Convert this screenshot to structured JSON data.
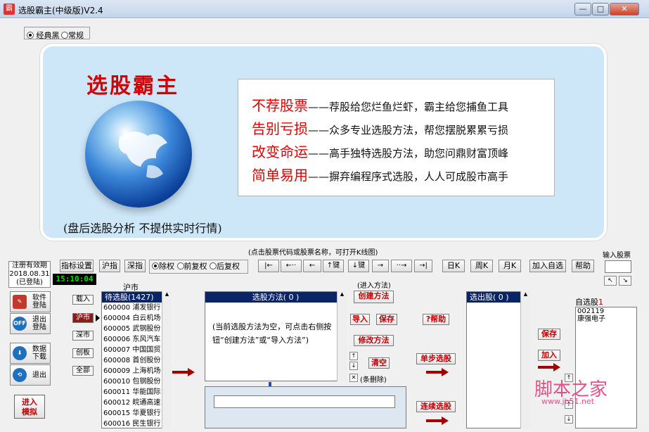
{
  "window": {
    "icon_text": "霸",
    "title": "选股霸主(中级版)V2.4",
    "min_glyph": "—",
    "max_glyph": "□",
    "close_glyph": "✕"
  },
  "theme": {
    "option1": "经典黑",
    "option2": "常规",
    "selected": "经典黑"
  },
  "banner": {
    "brand": "选股霸主",
    "note": "(盘后选股分析  不提供实时行情)",
    "slogans": [
      {
        "head": "不荐股票",
        "text": "——荐股给您烂鱼烂虾，霸主给您捕鱼工具"
      },
      {
        "head": "告别亏损",
        "text": "——众多专业选股方法，帮您摆脱累累亏损"
      },
      {
        "head": "改变命运",
        "text": "——高手独特选股方法，助您问鼎财富顶峰"
      },
      {
        "head": "简单易用",
        "text": "——摒弃编程序式选股，人人可成股市高手"
      }
    ]
  },
  "hint_open_kline": "(点击股票代码或股票名称，可打开K线图)",
  "registration": {
    "line1": "注册有效期",
    "line2": "2018.08.31",
    "line3": "(已登陆)"
  },
  "clock": "15:10:04",
  "toolbar": {
    "indicator_settings": "指标设置",
    "sh_index": "沪指",
    "sz_index": "深指",
    "fq_options": [
      "除权",
      "前复权",
      "后复权"
    ],
    "fq_selected": "除权",
    "nav_buttons": [
      "|←",
      "←··",
      "←",
      "↑键",
      "↓键",
      "→",
      "··→",
      "→|"
    ],
    "day_k": "日K",
    "week_k": "周K",
    "month_k": "月K",
    "add_watch": "加入自选",
    "help": "帮助",
    "input_code_label": "输入股票",
    "arrow_left": "↖",
    "arrow_right": "↘"
  },
  "sidebar": {
    "software_login": {
      "line1": "软件",
      "line2": "登陆"
    },
    "logout": {
      "line1": "退出",
      "line2": "登陆",
      "icon": "OFF"
    },
    "data_download": {
      "line1": "数据",
      "line2": "下载"
    },
    "exit": {
      "line1": "退出"
    },
    "enter_model": {
      "line1": "进入",
      "line2": "模拟"
    }
  },
  "market": {
    "label": "沪市",
    "buttons": [
      "载入",
      "沪市",
      "深市",
      "创板",
      "全部"
    ],
    "selected": "沪市"
  },
  "pending_list": {
    "header": "待选股(1427)",
    "rows": [
      "600000 浦发银行",
      "600004 白云机场",
      "600005 武钢股份",
      "600006 东风汽车",
      "600007 中国国贸",
      "600008 首创股份",
      "600009 上海机场",
      "600010 包钢股份",
      "600011 华能国际",
      "600012 皖通高速",
      "600015 华夏银行",
      "600016 民生银行"
    ]
  },
  "method": {
    "header": "选股方法(   0   )",
    "enter_label": "(进入方法)",
    "empty_hint": "(当前选股方法为空，可点击右侧按钮“创建方法”或“导入方法”)",
    "create": "创建方法",
    "import": "导入",
    "save": "保存",
    "edit": "修改方法",
    "clear": "清空",
    "delete_hint": "(条删除)",
    "help": "?帮助",
    "single_step": "单步选股",
    "continuous": "连续选股"
  },
  "selected_list": {
    "header": "选出股(   0   )"
  },
  "watchlist": {
    "label": "自选股",
    "count": "1",
    "save": "保存",
    "add": "加入",
    "items": [
      "002119",
      "康强电子"
    ]
  },
  "watermark": {
    "logo": "脚本之家",
    "url": "www.jb51.net"
  },
  "colors": {
    "title_red": "#d40000",
    "list_header": "#0a246a",
    "banner_bg": "#cde7f8",
    "arrow_red": "#a00000"
  }
}
